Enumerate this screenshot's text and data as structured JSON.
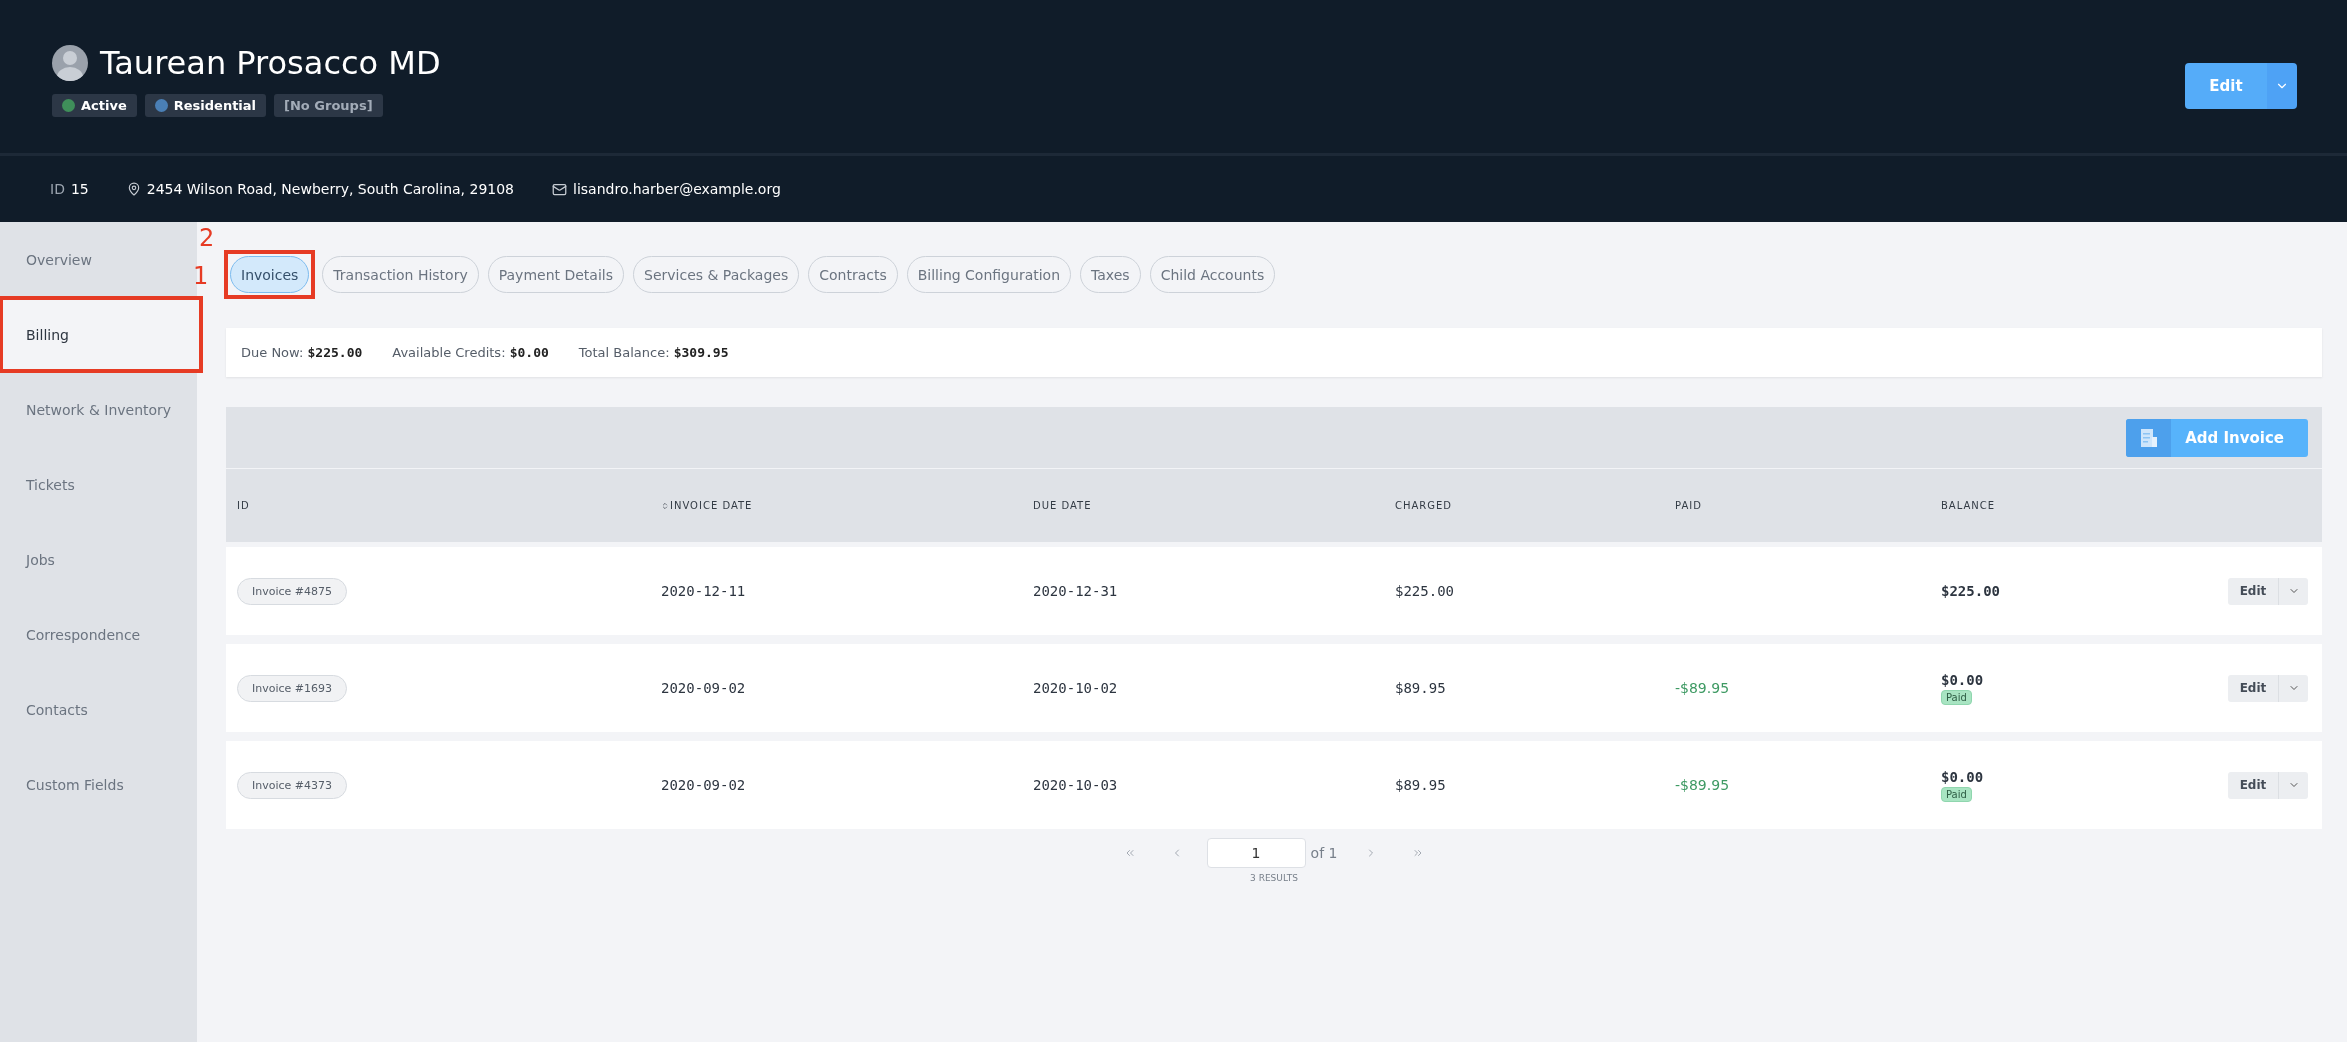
{
  "header": {
    "name": "Taurean Prosacco MD",
    "badges": [
      {
        "label": "Active",
        "color": "#3f8f5a"
      },
      {
        "label": "Residential",
        "color": "#4a7fb5"
      },
      {
        "label": "[No Groups]"
      }
    ],
    "edit_button": "Edit",
    "id_label": "ID",
    "id_value": "15",
    "address": "2454 Wilson Road, Newberry, South Carolina, 29108",
    "email": "lisandro.harber@example.org"
  },
  "sidebar": {
    "items": [
      {
        "label": "Overview",
        "selected": false,
        "highlighted": false
      },
      {
        "label": "Billing",
        "selected": true,
        "highlighted": true
      },
      {
        "label": "Network & Inventory",
        "selected": false,
        "highlighted": false
      },
      {
        "label": "Tickets",
        "selected": false,
        "highlighted": false
      },
      {
        "label": "Jobs",
        "selected": false,
        "highlighted": false
      },
      {
        "label": "Correspondence",
        "selected": false,
        "highlighted": false
      },
      {
        "label": "Contacts",
        "selected": false,
        "highlighted": false
      },
      {
        "label": "Custom Fields",
        "selected": false,
        "highlighted": false
      }
    ]
  },
  "tabs": [
    {
      "label": "Invoices",
      "selected": true,
      "highlighted": true
    },
    {
      "label": "Transaction History",
      "selected": false,
      "highlighted": false
    },
    {
      "label": "Payment Details",
      "selected": false,
      "highlighted": false
    },
    {
      "label": "Services & Packages",
      "selected": false,
      "highlighted": false
    },
    {
      "label": "Contracts",
      "selected": false,
      "highlighted": false
    },
    {
      "label": "Billing Configuration",
      "selected": false,
      "highlighted": false
    },
    {
      "label": "Taxes",
      "selected": false,
      "highlighted": false
    },
    {
      "label": "Child Accounts",
      "selected": false,
      "highlighted": false
    }
  ],
  "annotation_numbers": [
    "2",
    "1"
  ],
  "summary": [
    {
      "label": "Due Now:",
      "value": "$225.00"
    },
    {
      "label": "Available Credits:",
      "value": "$0.00"
    },
    {
      "label": "Total Balance:",
      "value": "$309.95"
    }
  ],
  "toolbar": {
    "add_button": "Add Invoice"
  },
  "table": {
    "columns": [
      {
        "label": "ID",
        "sortable": false
      },
      {
        "label": "INVOICE DATE",
        "sortable": true
      },
      {
        "label": "DUE DATE",
        "sortable": false
      },
      {
        "label": "CHARGED",
        "sortable": false
      },
      {
        "label": "PAID",
        "sortable": false
      },
      {
        "label": "BALANCE",
        "sortable": false
      }
    ],
    "rows": [
      {
        "id": "Invoice #4875",
        "invoice_date": "2020-12-11",
        "due_date": "2020-12-31",
        "charged": "$225.00",
        "balance": "$225.00",
        "action": "Edit"
      },
      {
        "id": "Invoice #1693",
        "invoice_date": "2020-09-02",
        "due_date": "2020-10-02",
        "charged": "$89.95",
        "paid": "-$89.95",
        "balance": "$0.00",
        "status": "Paid",
        "action": "Edit"
      },
      {
        "id": "Invoice #4373",
        "invoice_date": "2020-09-02",
        "due_date": "2020-10-03",
        "charged": "$89.95",
        "paid": "-$89.95",
        "balance": "$0.00",
        "status": "Paid",
        "action": "Edit"
      }
    ]
  },
  "pagination": {
    "page": "1",
    "of": "of 1",
    "results": "3 RESULTS"
  }
}
